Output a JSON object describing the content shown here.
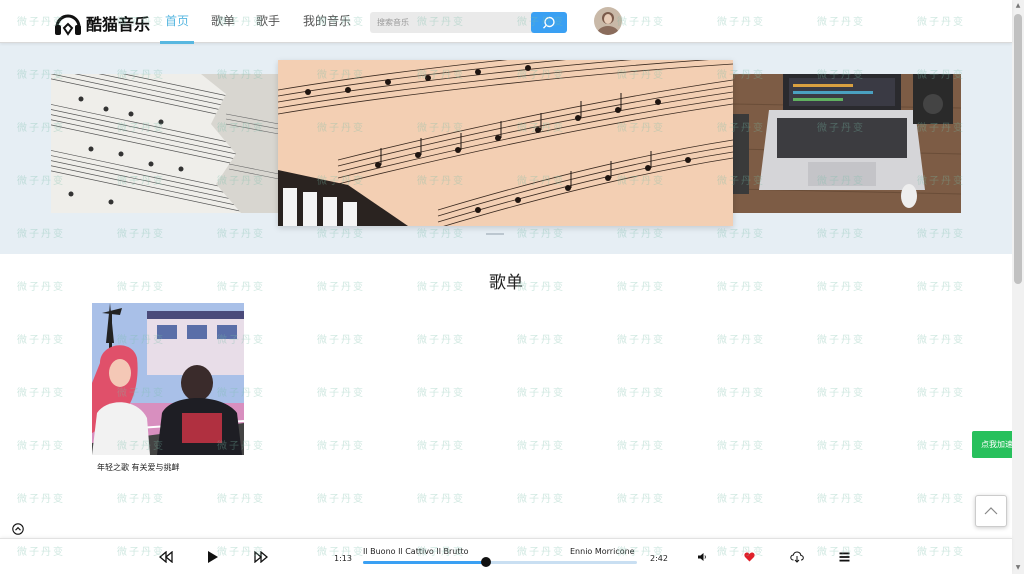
{
  "app": {
    "logo_text": "酷猫音乐",
    "nav": [
      {
        "label": "首页",
        "active": true
      },
      {
        "label": "歌单",
        "active": false
      },
      {
        "label": "歌手",
        "active": false
      },
      {
        "label": "我的音乐",
        "active": false
      }
    ],
    "search_placeholder": "搜索音乐",
    "accent_color": "#3aa0f3"
  },
  "banner": {
    "slides": [
      "sheet-music-left",
      "sheet-music-piano",
      "laptop-desk"
    ],
    "active_index": 1
  },
  "section": {
    "title": "歌单",
    "playlists": [
      {
        "name": "年轻之歌 有关爱与挑衅"
      }
    ]
  },
  "side": {
    "speed_label": "点我加速!"
  },
  "player": {
    "current_time": "1:13",
    "total_time": "2:42",
    "song_title": "Il Buono Il Cattivo Il Brutto",
    "artist": "Ennio Morricone",
    "progress_fraction": 0.45,
    "liked": true,
    "like_color": "#e0202a"
  },
  "watermark": "微子丹变"
}
